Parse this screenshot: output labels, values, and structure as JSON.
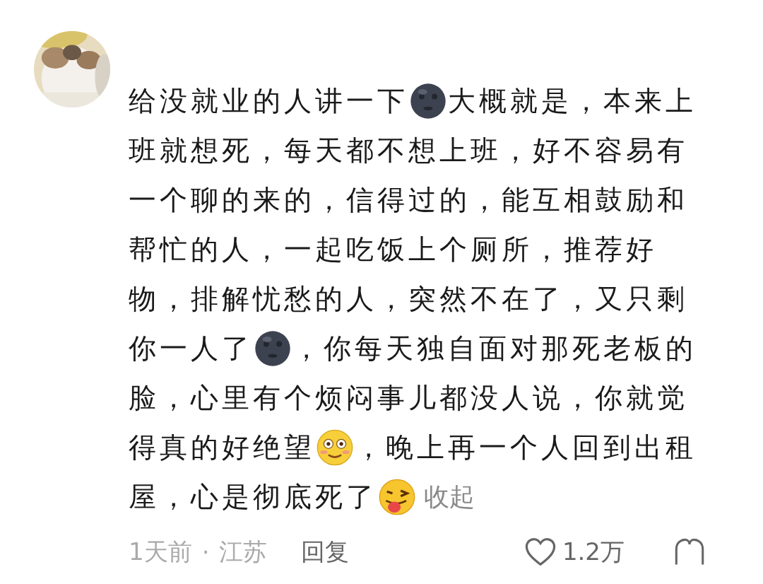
{
  "comment": {
    "lines": [
      [
        {
          "kind": "text",
          "text": "给没就业的人讲一下"
        },
        {
          "kind": "moon-emoji"
        },
        {
          "kind": "text",
          "text": "大概就是，本来上"
        }
      ],
      [
        {
          "kind": "text",
          "text": "班就想死，每天都不想上班，好不容易有"
        }
      ],
      [
        {
          "kind": "text",
          "text": "一个聊的来的，信得过的，能互相鼓励和"
        }
      ],
      [
        {
          "kind": "text",
          "text": "帮忙的人，一起吃饭上个厕所，推荐好"
        }
      ],
      [
        {
          "kind": "text",
          "text": "物，排解忧愁的人，突然不在了，又只剩"
        }
      ],
      [
        {
          "kind": "text",
          "text": "你一人了"
        },
        {
          "kind": "moon-emoji"
        },
        {
          "kind": "text",
          "text": "，你每天独自面对那死老板的"
        }
      ],
      [
        {
          "kind": "text",
          "text": "脸，心里有个烦闷事儿都没人说，你就觉"
        }
      ],
      [
        {
          "kind": "text",
          "text": "得真的好绝望"
        },
        {
          "kind": "blush-emoji"
        },
        {
          "kind": "text",
          "text": "，晚上再一个人回到出租"
        }
      ],
      [
        {
          "kind": "text",
          "text": "屋，心是彻底死了"
        },
        {
          "kind": "wink-emoji"
        },
        {
          "kind": "link",
          "text": "收起"
        }
      ]
    ],
    "time": "1天前",
    "separator": "·",
    "location": "江苏",
    "reply": "回复",
    "likes": "1.2万"
  }
}
